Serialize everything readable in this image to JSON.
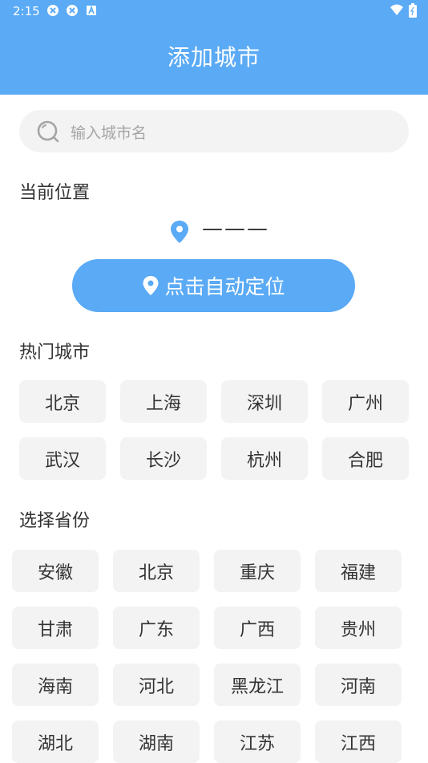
{
  "status_bar": {
    "time": "2:15",
    "left_icons": [
      "sync-icon",
      "sync-icon",
      "notification-a-icon"
    ],
    "right_icons": [
      "wifi-icon",
      "battery-icon"
    ]
  },
  "header": {
    "title": "添加城市",
    "bg_color": "#5aaaf5"
  },
  "search": {
    "placeholder": "输入城市名"
  },
  "current_location": {
    "heading": "当前位置",
    "value": "———",
    "locate_button_label": "点击自动定位"
  },
  "hot_cities": {
    "heading": "热门城市",
    "items": [
      "北京",
      "上海",
      "深圳",
      "广州",
      "武汉",
      "长沙",
      "杭州",
      "合肥"
    ]
  },
  "provinces": {
    "heading": "选择省份",
    "items": [
      "安徽",
      "北京",
      "重庆",
      "福建",
      "甘肃",
      "广东",
      "广西",
      "贵州",
      "海南",
      "河北",
      "黑龙江",
      "河南",
      "湖北",
      "湖南",
      "江苏",
      "江西"
    ]
  }
}
